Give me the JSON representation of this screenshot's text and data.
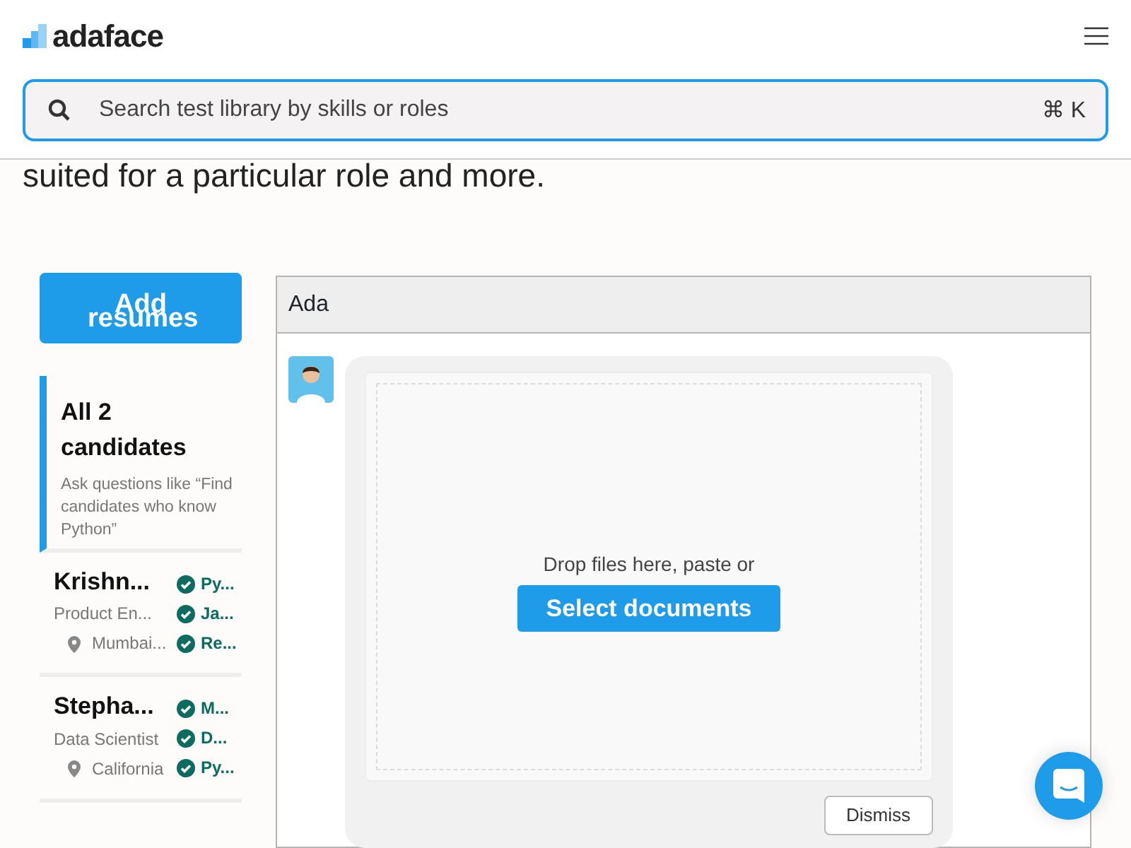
{
  "header": {
    "logo": "adaface",
    "search": {
      "placeholder": "Search test library by skills or roles",
      "shortcut": "⌘ K"
    }
  },
  "intro_text": "suited for a particular role and more.",
  "add_button": "Add resumes",
  "candidate_list": [
    {
      "kind": "all",
      "title": "All 2 candidates",
      "hint": "Ask questions like “Find candidates who know Python”",
      "selected": true
    },
    {
      "kind": "candidate",
      "name": "Krishn...",
      "role": "Product En...",
      "location": "Mumbai...",
      "skills": [
        "Py...",
        "Ja...",
        "Re..."
      ],
      "selected": false
    },
    {
      "kind": "candidate",
      "name": "Stepha...",
      "role": "Data Scientist",
      "location": "California",
      "skills": [
        "M...",
        "D...",
        "Py..."
      ],
      "selected": false
    }
  ],
  "chat": {
    "title": "Ada",
    "drop_text": "Drop files here, paste or",
    "select_button": "Select documents",
    "dismiss_button": "Dismiss"
  }
}
